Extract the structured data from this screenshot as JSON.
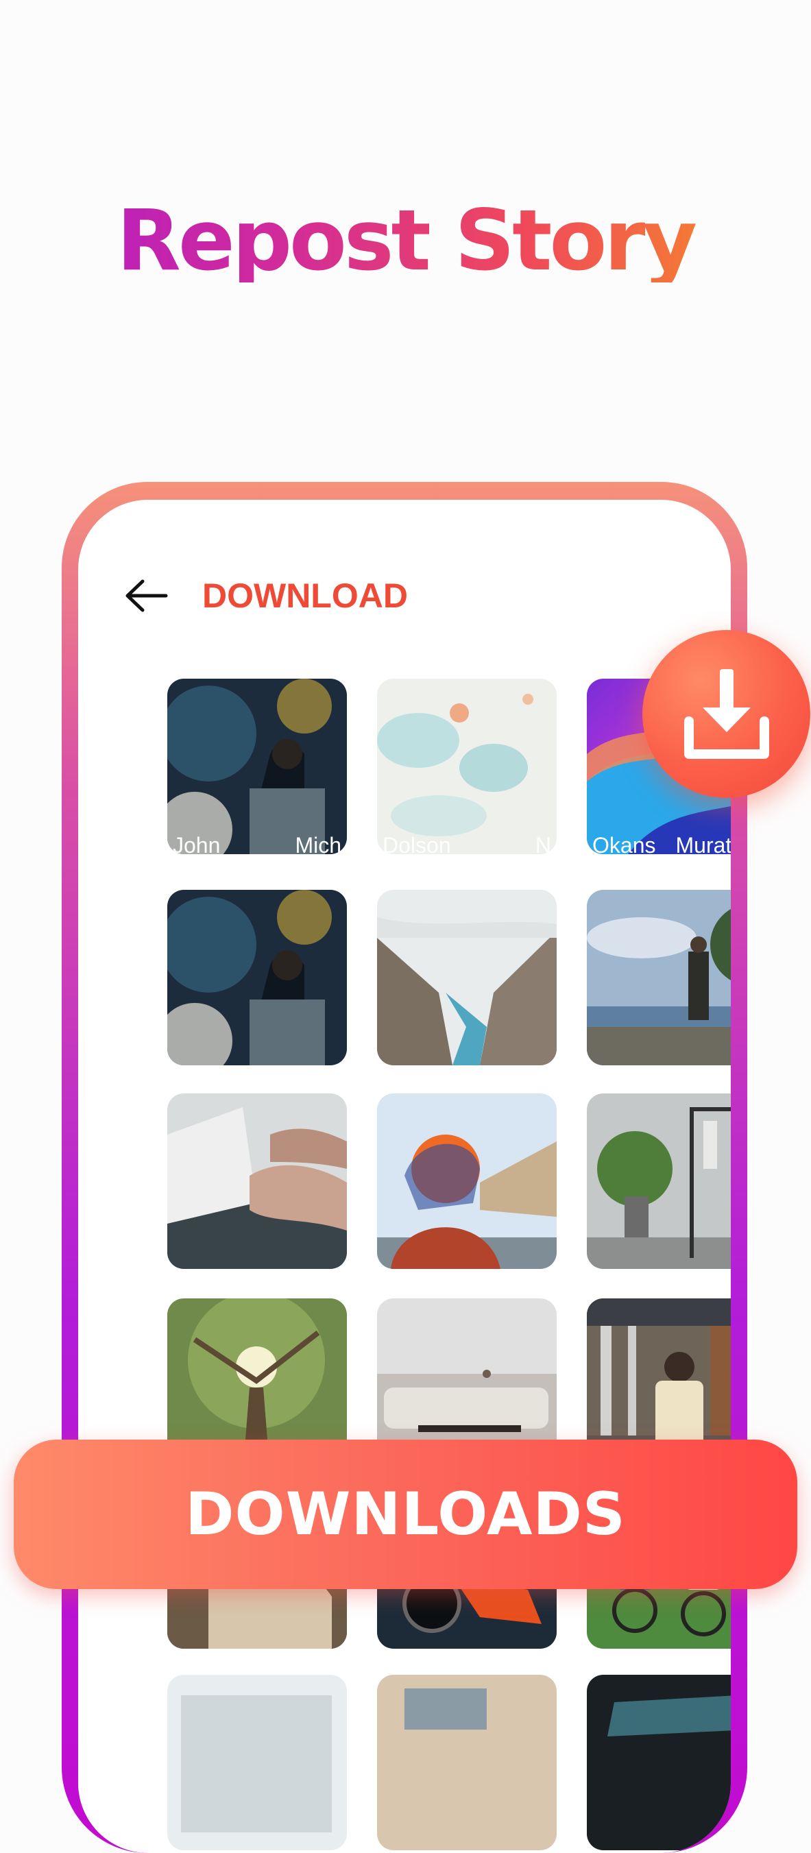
{
  "headline": "Repost Story",
  "app": {
    "title": "DOWNLOAD"
  },
  "icons": {
    "back": "arrow-left-icon",
    "download": "download-icon"
  },
  "tile_names": [
    "John",
    "Mich",
    "Dolson",
    "N",
    "Okans",
    "Murat Ja"
  ],
  "tiles": [
    {
      "scene": "drummer-concert"
    },
    {
      "scene": "watercolor-texture"
    },
    {
      "scene": "purple-blue-waves"
    },
    {
      "scene": "drummer-concert"
    },
    {
      "scene": "mountain-river-valley"
    },
    {
      "scene": "man-on-lake-shore"
    },
    {
      "scene": "typing-on-laptop"
    },
    {
      "scene": "woman-orange-headscarf"
    },
    {
      "scene": "plant-and-clothes-rack"
    },
    {
      "scene": "sunlit-tree"
    },
    {
      "scene": "living-room-sofa"
    },
    {
      "scene": "man-in-corridor"
    },
    {
      "scene": "hand-on-knee"
    },
    {
      "scene": "motorcycle"
    },
    {
      "scene": "cyclists-in-field"
    },
    {
      "scene": "building-facade"
    },
    {
      "scene": "desk-laptop"
    },
    {
      "scene": "dark-car"
    }
  ],
  "banner": {
    "label": "DOWNLOADS"
  },
  "colors": {
    "accent": "#ee4a35",
    "frame_top": "#f6917a",
    "frame_bottom": "#c20bd0",
    "banner": "#fb5f49"
  }
}
